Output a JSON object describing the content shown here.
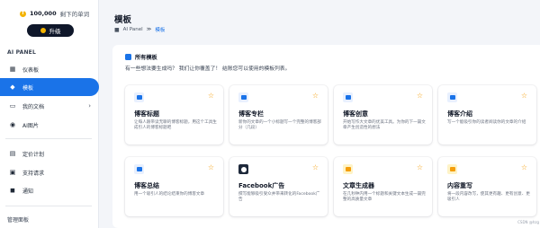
{
  "sidebar": {
    "credits_value": "100,000",
    "credits_text": "剩下的单词",
    "upgrade_label": "升级",
    "section_title": "AI PANEL",
    "items": [
      {
        "label": "仪表板",
        "icon": "dashboard-icon"
      },
      {
        "label": "模板",
        "icon": "template-icon"
      },
      {
        "label": "我的文档",
        "icon": "folder-icon"
      },
      {
        "label": "AI图片",
        "icon": "image-icon"
      },
      {
        "label": "定价计划",
        "icon": "pricing-icon"
      },
      {
        "label": "支持请求",
        "icon": "support-icon"
      },
      {
        "label": "通知",
        "icon": "notification-icon"
      }
    ],
    "bottom_label": "管理面板"
  },
  "header": {
    "title": "模板",
    "breadcrumb": {
      "root": "AI Panel",
      "separator": "≫",
      "current": "模板"
    }
  },
  "panel": {
    "title": "所有模板",
    "subtitle": "有一些想法要生成吗？ 我们让你覆盖了！ 结账您可以使用的模板列表。"
  },
  "cards": [
    {
      "title": "博客标题",
      "desc": "让每人跟带读无聊的博客标题，用这个工具生成引人的博客标题吧",
      "icon": "chat-icon",
      "color": "#1a73e8",
      "bg": "#e8f0fe"
    },
    {
      "title": "博客专栏",
      "desc": "新你的文章的一个小标题写一个完整的博客部分（几段）",
      "icon": "chat-icon",
      "color": "#1a73e8",
      "bg": "#e8f0fe"
    },
    {
      "title": "博客创意",
      "desc": "开始写作大文章的优美工具。为你的下一篇文章产生创造性的想法",
      "icon": "chat-icon",
      "color": "#1a73e8",
      "bg": "#e8f0fe"
    },
    {
      "title": "博客介绍",
      "desc": "写一个能吸引你的读者阅读你的文章的介绍",
      "icon": "chat-icon",
      "color": "#1a73e8",
      "bg": "#e8f0fe"
    },
    {
      "title": "博客总结",
      "desc": "用一个吸引人的结论结束你的博客文章",
      "icon": "monitor-icon",
      "color": "#1a73e8",
      "bg": "#e8f0fe"
    },
    {
      "title": "Facebook广告",
      "desc": "撰写能够吸引受众并带来转化的Facebook广告",
      "icon": "facebook-icon",
      "color": "#1e293b",
      "bg": "#1e293b"
    },
    {
      "title": "文章生成器",
      "desc": "在几秒钟内用一个标题和关键文本生成一篇完整的高质量文章",
      "icon": "document-icon",
      "color": "#f59e0b",
      "bg": "#fef3c7"
    },
    {
      "title": "内容重写",
      "desc": "将一段内容改写，使其更有趣、更有创意、更吸引人",
      "icon": "edit-icon",
      "color": "#f59e0b",
      "bg": "#fef3c7"
    }
  ],
  "watermark": "CSDN @hzg"
}
